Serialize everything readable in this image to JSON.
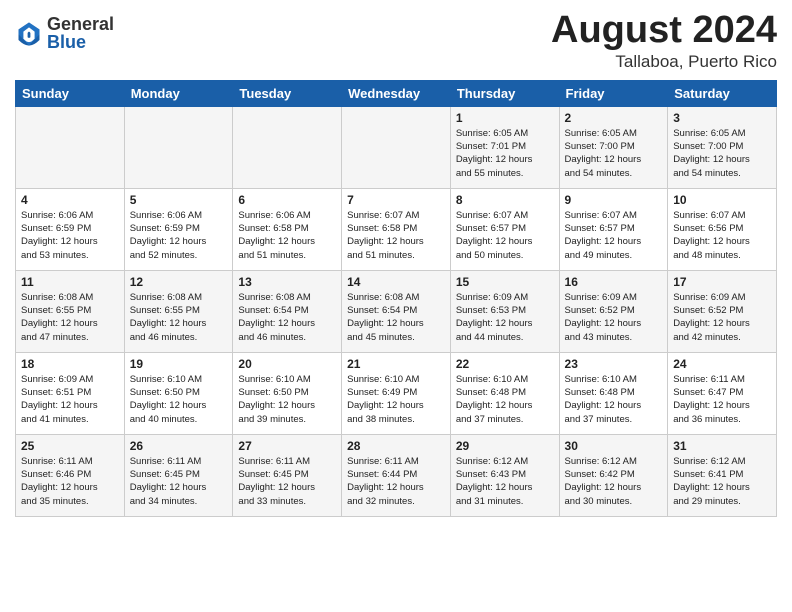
{
  "header": {
    "logo_general": "General",
    "logo_blue": "Blue",
    "title": "August 2024",
    "subtitle": "Tallaboa, Puerto Rico"
  },
  "days_of_week": [
    "Sunday",
    "Monday",
    "Tuesday",
    "Wednesday",
    "Thursday",
    "Friday",
    "Saturday"
  ],
  "weeks": [
    [
      {
        "day": "",
        "info": ""
      },
      {
        "day": "",
        "info": ""
      },
      {
        "day": "",
        "info": ""
      },
      {
        "day": "",
        "info": ""
      },
      {
        "day": "1",
        "info": "Sunrise: 6:05 AM\nSunset: 7:01 PM\nDaylight: 12 hours\nand 55 minutes."
      },
      {
        "day": "2",
        "info": "Sunrise: 6:05 AM\nSunset: 7:00 PM\nDaylight: 12 hours\nand 54 minutes."
      },
      {
        "day": "3",
        "info": "Sunrise: 6:05 AM\nSunset: 7:00 PM\nDaylight: 12 hours\nand 54 minutes."
      }
    ],
    [
      {
        "day": "4",
        "info": "Sunrise: 6:06 AM\nSunset: 6:59 PM\nDaylight: 12 hours\nand 53 minutes."
      },
      {
        "day": "5",
        "info": "Sunrise: 6:06 AM\nSunset: 6:59 PM\nDaylight: 12 hours\nand 52 minutes."
      },
      {
        "day": "6",
        "info": "Sunrise: 6:06 AM\nSunset: 6:58 PM\nDaylight: 12 hours\nand 51 minutes."
      },
      {
        "day": "7",
        "info": "Sunrise: 6:07 AM\nSunset: 6:58 PM\nDaylight: 12 hours\nand 51 minutes."
      },
      {
        "day": "8",
        "info": "Sunrise: 6:07 AM\nSunset: 6:57 PM\nDaylight: 12 hours\nand 50 minutes."
      },
      {
        "day": "9",
        "info": "Sunrise: 6:07 AM\nSunset: 6:57 PM\nDaylight: 12 hours\nand 49 minutes."
      },
      {
        "day": "10",
        "info": "Sunrise: 6:07 AM\nSunset: 6:56 PM\nDaylight: 12 hours\nand 48 minutes."
      }
    ],
    [
      {
        "day": "11",
        "info": "Sunrise: 6:08 AM\nSunset: 6:55 PM\nDaylight: 12 hours\nand 47 minutes."
      },
      {
        "day": "12",
        "info": "Sunrise: 6:08 AM\nSunset: 6:55 PM\nDaylight: 12 hours\nand 46 minutes."
      },
      {
        "day": "13",
        "info": "Sunrise: 6:08 AM\nSunset: 6:54 PM\nDaylight: 12 hours\nand 46 minutes."
      },
      {
        "day": "14",
        "info": "Sunrise: 6:08 AM\nSunset: 6:54 PM\nDaylight: 12 hours\nand 45 minutes."
      },
      {
        "day": "15",
        "info": "Sunrise: 6:09 AM\nSunset: 6:53 PM\nDaylight: 12 hours\nand 44 minutes."
      },
      {
        "day": "16",
        "info": "Sunrise: 6:09 AM\nSunset: 6:52 PM\nDaylight: 12 hours\nand 43 minutes."
      },
      {
        "day": "17",
        "info": "Sunrise: 6:09 AM\nSunset: 6:52 PM\nDaylight: 12 hours\nand 42 minutes."
      }
    ],
    [
      {
        "day": "18",
        "info": "Sunrise: 6:09 AM\nSunset: 6:51 PM\nDaylight: 12 hours\nand 41 minutes."
      },
      {
        "day": "19",
        "info": "Sunrise: 6:10 AM\nSunset: 6:50 PM\nDaylight: 12 hours\nand 40 minutes."
      },
      {
        "day": "20",
        "info": "Sunrise: 6:10 AM\nSunset: 6:50 PM\nDaylight: 12 hours\nand 39 minutes."
      },
      {
        "day": "21",
        "info": "Sunrise: 6:10 AM\nSunset: 6:49 PM\nDaylight: 12 hours\nand 38 minutes."
      },
      {
        "day": "22",
        "info": "Sunrise: 6:10 AM\nSunset: 6:48 PM\nDaylight: 12 hours\nand 37 minutes."
      },
      {
        "day": "23",
        "info": "Sunrise: 6:10 AM\nSunset: 6:48 PM\nDaylight: 12 hours\nand 37 minutes."
      },
      {
        "day": "24",
        "info": "Sunrise: 6:11 AM\nSunset: 6:47 PM\nDaylight: 12 hours\nand 36 minutes."
      }
    ],
    [
      {
        "day": "25",
        "info": "Sunrise: 6:11 AM\nSunset: 6:46 PM\nDaylight: 12 hours\nand 35 minutes."
      },
      {
        "day": "26",
        "info": "Sunrise: 6:11 AM\nSunset: 6:45 PM\nDaylight: 12 hours\nand 34 minutes."
      },
      {
        "day": "27",
        "info": "Sunrise: 6:11 AM\nSunset: 6:45 PM\nDaylight: 12 hours\nand 33 minutes."
      },
      {
        "day": "28",
        "info": "Sunrise: 6:11 AM\nSunset: 6:44 PM\nDaylight: 12 hours\nand 32 minutes."
      },
      {
        "day": "29",
        "info": "Sunrise: 6:12 AM\nSunset: 6:43 PM\nDaylight: 12 hours\nand 31 minutes."
      },
      {
        "day": "30",
        "info": "Sunrise: 6:12 AM\nSunset: 6:42 PM\nDaylight: 12 hours\nand 30 minutes."
      },
      {
        "day": "31",
        "info": "Sunrise: 6:12 AM\nSunset: 6:41 PM\nDaylight: 12 hours\nand 29 minutes."
      }
    ]
  ]
}
